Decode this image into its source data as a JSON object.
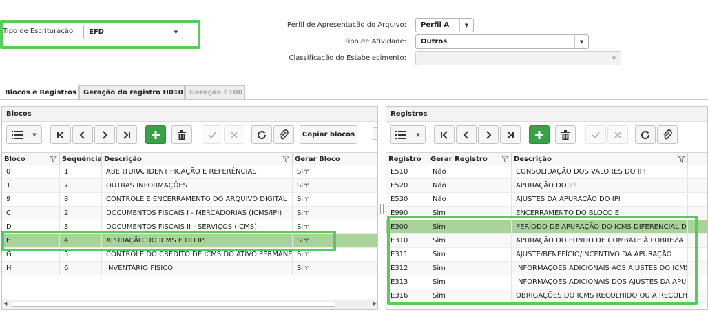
{
  "filters": {
    "tipo_escrituracao_label": "Tipo de Escrituração:",
    "tipo_escrituracao_value": "EFD",
    "perfil_label": "Perfil de Apresentação do Arquivo:",
    "perfil_value": "Perfil A",
    "atividade_label": "Tipo de Atividade:",
    "atividade_value": "Outros",
    "classificacao_label": "Classificação do Estabelecimento:",
    "classificacao_value": ""
  },
  "tabs": [
    {
      "label": "Blocos e Registros",
      "state": "active"
    },
    {
      "label": "Geração do registro H010",
      "state": "normal"
    },
    {
      "label": "Geração F100",
      "state": "disabled"
    }
  ],
  "blocos": {
    "title": "Blocos",
    "copy_label": "Copiar blocos",
    "columns": [
      "Bloco",
      "Sequência",
      "Descrição",
      "Gerar Bloco"
    ],
    "rows": [
      {
        "bloco": "0",
        "seq": "1",
        "desc": "ABERTURA, IDENTIFICAÇÃO E REFERÊNCIAS",
        "gerar": "Sim"
      },
      {
        "bloco": "1",
        "seq": "7",
        "desc": "OUTRAS INFORMAÇÕES",
        "gerar": "Sim"
      },
      {
        "bloco": "9",
        "seq": "8",
        "desc": "CONTROLE E ENCERRAMENTO DO ARQUIVO DIGITAL",
        "gerar": "Sim"
      },
      {
        "bloco": "C",
        "seq": "2",
        "desc": "DOCUMENTOS FISCAIS I - MERCADORIAS (ICMS/IPI)",
        "gerar": "Sim"
      },
      {
        "bloco": "D",
        "seq": "3",
        "desc": "DOCUMENTOS FISCAIS II - SERVIÇOS (ICMS)",
        "gerar": "Sim"
      },
      {
        "bloco": "E",
        "seq": "4",
        "desc": "APURAÇÃO DO ICMS E DO IPI",
        "gerar": "Sim",
        "selected": true
      },
      {
        "bloco": "G",
        "seq": "5",
        "desc": "CONTROLE DO CRÉDITO DE ICMS DO ATIVO PERMANENTE",
        "gerar": "Sim"
      },
      {
        "bloco": "H",
        "seq": "6",
        "desc": "INVENTÁRIO FÍSICO",
        "gerar": "Sim"
      }
    ]
  },
  "registros": {
    "title": "Registros",
    "columns": [
      "Registro",
      "Gerar Registro",
      "Descrição"
    ],
    "rows": [
      {
        "reg": "E510",
        "gerar": "Não",
        "desc": "CONSOLIDAÇÃO DOS VALORES DO IPI"
      },
      {
        "reg": "E520",
        "gerar": "Não",
        "desc": "APURAÇÃO DO IPI"
      },
      {
        "reg": "E530",
        "gerar": "Não",
        "desc": " AJUSTES DA APURAÇÃO DO IPI"
      },
      {
        "reg": "E990",
        "gerar": "Sim",
        "desc": "ENCERRAMENTO DO BLOCO E"
      },
      {
        "reg": "E300",
        "gerar": "Sim",
        "desc": "PERÍODO DE APURAÇÃO DO ICMS DIFERENCIAL DE ALÍQUOTA",
        "selected": true
      },
      {
        "reg": "E310",
        "gerar": "Sim",
        "desc": "APURAÇÃO DO FUNDO DE COMBATE À POBREZA"
      },
      {
        "reg": "E311",
        "gerar": "Sim",
        "desc": "AJUSTE/BENEFÍCIO/INCENTIVO DA APURAÇÃO"
      },
      {
        "reg": "E312",
        "gerar": "Sim",
        "desc": "INFORMAÇÕES ADICIONAIS AOS AJUSTES DO ICMS"
      },
      {
        "reg": "E313",
        "gerar": "Sim",
        "desc": "INFORMAÇÕES ADICIONAIS DOS AJUSTES DA APURAÇÃO"
      },
      {
        "reg": "E316",
        "gerar": "Sim",
        "desc": "OBRIGAÇÕES DO ICMS RECOLHIDO OU A RECOLHER"
      }
    ]
  },
  "toolbar_icons": [
    "list-icon",
    "first-icon",
    "prev-icon",
    "next-icon",
    "last-icon",
    "add-icon",
    "delete-icon",
    "confirm-icon",
    "cancel-icon",
    "refresh-icon",
    "attach-icon"
  ],
  "colors": {
    "accent_green": "#3aa14a",
    "highlight_green": "#5ec75e",
    "selected_row": "#a9d39a"
  }
}
